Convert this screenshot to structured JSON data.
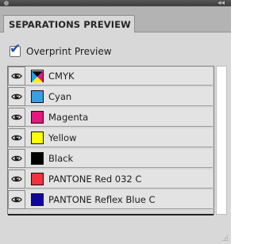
{
  "panel": {
    "title": "SEPARATIONS PREVIEW",
    "collapse_glyph": "◂◂"
  },
  "overprint": {
    "label": "Overprint Preview",
    "checked": true
  },
  "separations": [
    {
      "name": "CMYK",
      "color": "cmyk",
      "visible": true
    },
    {
      "name": "Cyan",
      "color": "#3a9fe0",
      "visible": true
    },
    {
      "name": "Magenta",
      "color": "#e0197d",
      "visible": true
    },
    {
      "name": "Yellow",
      "color": "#ffff00",
      "visible": true
    },
    {
      "name": "Black",
      "color": "#000000",
      "visible": true
    },
    {
      "name": "PANTONE Red 032 C",
      "color": "#ef3340",
      "visible": true
    },
    {
      "name": "PANTONE Reflex Blue C",
      "color": "#10069f",
      "visible": true
    }
  ],
  "icons": {
    "visibility": "eye-icon",
    "check": "checkmark-icon",
    "resize": "resize-grip-icon"
  }
}
